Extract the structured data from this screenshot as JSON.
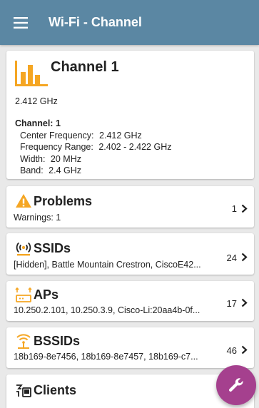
{
  "appbar": {
    "title": "Wi-Fi - Channel",
    "menu_icon": "hamburger-menu-icon",
    "color": "#5b87a3"
  },
  "channel": {
    "icon": "channel-bars-icon",
    "title": "Channel 1",
    "frequency": "2.412 GHz",
    "details": {
      "heading": "Channel:",
      "number": "1",
      "rows": [
        {
          "key": "Center Frequency:",
          "value": "2.412 GHz"
        },
        {
          "key": "Frequency Range:",
          "value": "2.402 - 2.422 GHz"
        },
        {
          "key": "Width:",
          "value": "20 MHz"
        },
        {
          "key": "Band:",
          "value": "2.4 GHz"
        }
      ]
    }
  },
  "problems": {
    "icon": "warning-icon",
    "title": "Problems",
    "subtitle": "Warnings: 1",
    "count": "1"
  },
  "ssids": {
    "icon": "ssid-broadcast-icon",
    "title": "SSIDs",
    "subtitle": "[Hidden], Battle Mountain Crestron, CiscoE42...",
    "count": "24"
  },
  "aps": {
    "icon": "access-point-icon",
    "title": "APs",
    "subtitle": "10.250.2.101, 10.250.3.9, Cisco-Li:20aa4b-0f...",
    "count": "17"
  },
  "bssids": {
    "icon": "bssid-wifi-icon",
    "title": "BSSIDs",
    "subtitle": "18b169-8e7456, 18b169-8e7457, 18b169-c7...",
    "count": "46"
  },
  "clients": {
    "icon": "clients-icon",
    "title": "Clients"
  },
  "fab": {
    "icon": "wrench-icon",
    "color": "#a5408e"
  },
  "colors": {
    "accent_orange": "#f5a623",
    "background": "#e9e9e9"
  }
}
